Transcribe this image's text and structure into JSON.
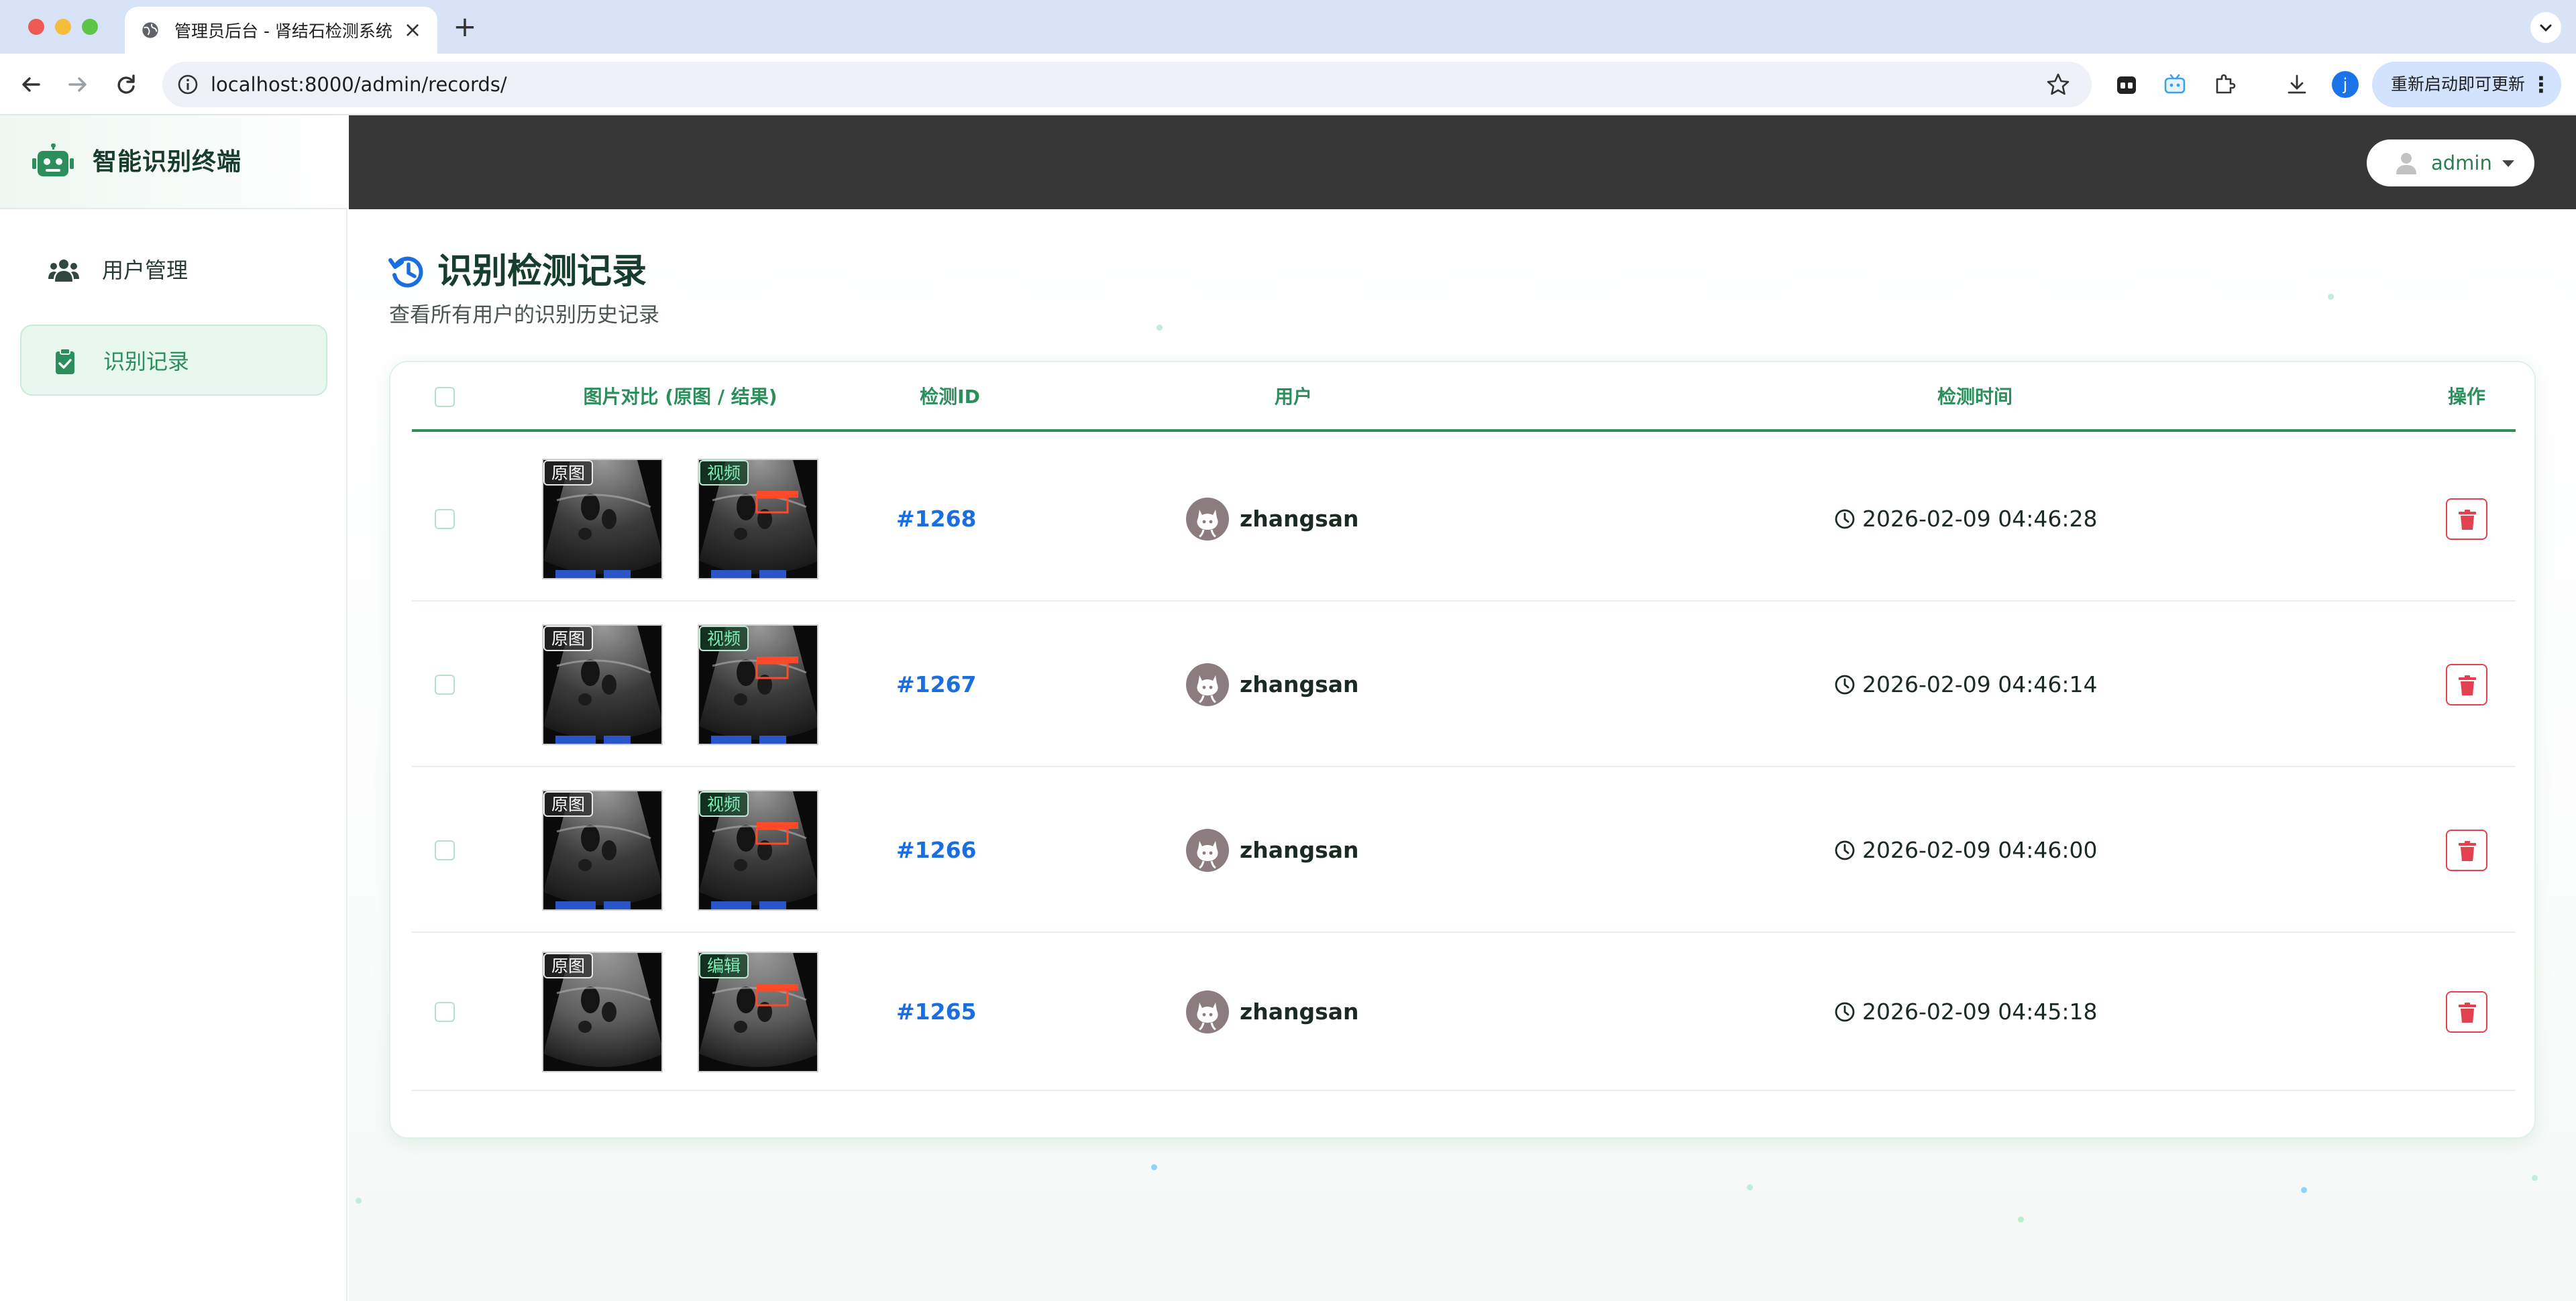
{
  "browser": {
    "tab_title": "管理员后台 - 肾结石检测系统",
    "url": "localhost:8000/admin/records/",
    "relaunch_label": "重新启动即可更新",
    "profile_initial": "j"
  },
  "sidebar": {
    "brand": "智能识别终端",
    "items": [
      {
        "label": "用户管理",
        "icon": "users-icon",
        "active": false
      },
      {
        "label": "识别记录",
        "icon": "clipboard-check-icon",
        "active": true
      }
    ]
  },
  "header": {
    "user": "admin"
  },
  "page": {
    "title": "识别检测记录",
    "subtitle": "查看所有用户的识别历史记录"
  },
  "table": {
    "columns": {
      "images": "图片对比 (原图 / 结果)",
      "id": "检测ID",
      "user": "用户",
      "time": "检测时间",
      "actions": "操作"
    },
    "original_tag": "原图",
    "rows": [
      {
        "id": "#1268",
        "result_tag": "视频",
        "user": "zhangsan",
        "time": "2026-02-09 04:46:28"
      },
      {
        "id": "#1267",
        "result_tag": "视频",
        "user": "zhangsan",
        "time": "2026-02-09 04:46:14"
      },
      {
        "id": "#1266",
        "result_tag": "视频",
        "user": "zhangsan",
        "time": "2026-02-09 04:46:00"
      },
      {
        "id": "#1265",
        "result_tag": "编辑",
        "user": "zhangsan",
        "time": "2026-02-09 04:45:18"
      }
    ]
  },
  "colors": {
    "accent": "#2b8e5b",
    "link": "#1a6ee0",
    "danger": "#e2414f",
    "topbar": "#373737"
  }
}
